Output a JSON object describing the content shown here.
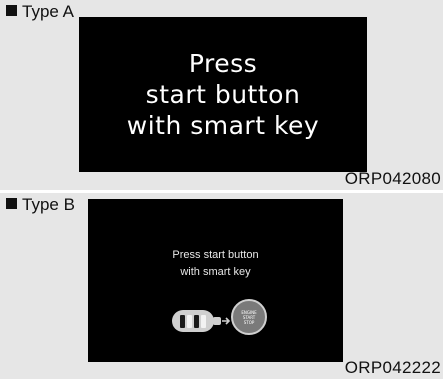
{
  "panels": [
    {
      "type_label": "Type A",
      "message_lines": [
        "Press",
        "start button",
        "with smart key"
      ],
      "code": "ORP042080"
    },
    {
      "type_label": "Type B",
      "message_lines": [
        "Press start button",
        "with smart key"
      ],
      "start_button_lines": [
        "ENGINE",
        "START",
        "STOP"
      ],
      "code": "ORP042222"
    }
  ],
  "icons": {
    "smart_key": "smart-key-icon",
    "arrow": "arrow-right-icon",
    "start_button": "engine-start-stop-button-icon"
  }
}
